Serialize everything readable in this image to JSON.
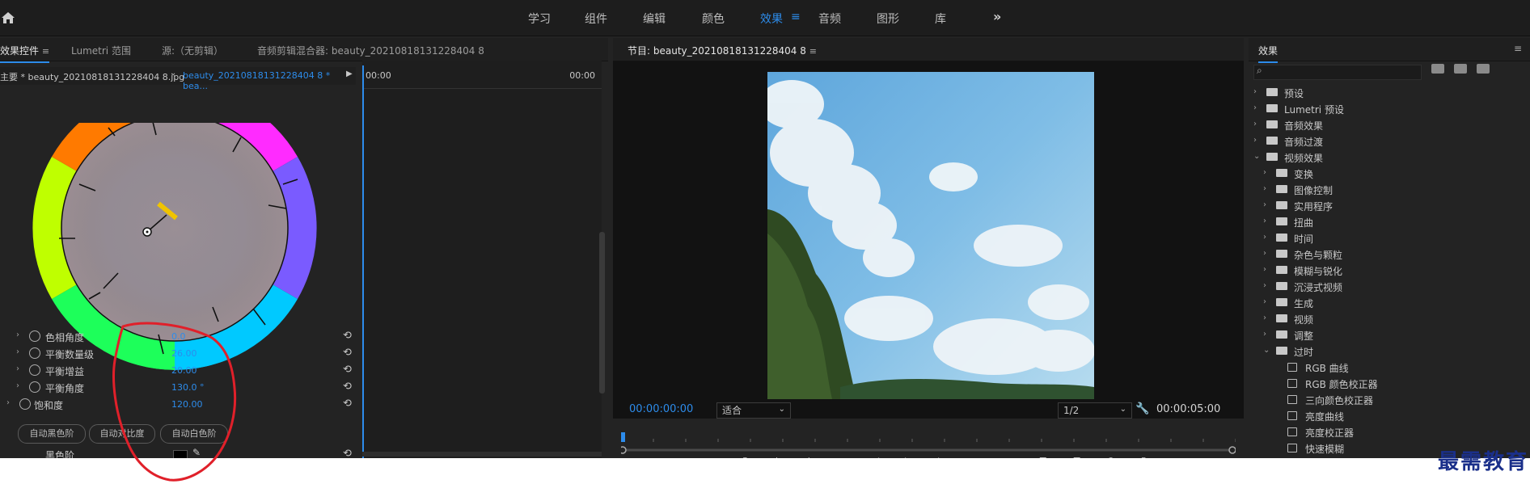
{
  "workspaces": [
    {
      "label": "学习",
      "active": false
    },
    {
      "label": "组件",
      "active": false
    },
    {
      "label": "编辑",
      "active": false
    },
    {
      "label": "颜色",
      "active": false
    },
    {
      "label": "效果",
      "active": true
    },
    {
      "label": "音频",
      "active": false
    },
    {
      "label": "图形",
      "active": false
    },
    {
      "label": "库",
      "active": false
    }
  ],
  "left": {
    "tabs": [
      "效果控件",
      "Lumetri 范围",
      "源:（无剪辑）",
      "音频剪辑混合器: beauty_20210818131228404 8"
    ],
    "source_a": "主要 * beauty_20210818131228404 8.jpg",
    "source_b": "beauty_20210818131228404 8 * bea...",
    "time_start": "00:00",
    "time_end": "00:00",
    "props": [
      {
        "label": "色相角度",
        "value": "0.0"
      },
      {
        "label": "平衡数量级",
        "value": "26.00"
      },
      {
        "label": "平衡增益",
        "value": "20.00"
      },
      {
        "label": "平衡角度",
        "value": "130.0 °"
      },
      {
        "label": "饱和度",
        "value": "120.00"
      }
    ],
    "buttons": [
      "自动黑色阶",
      "自动对比度",
      "自动白色阶"
    ],
    "black_level": "黑色阶"
  },
  "program": {
    "title": "节目: beauty_20210818131228404 8",
    "timecode_current": "00:00:00:00",
    "fit": "适合",
    "resolution": "1/2",
    "timecode_duration": "00:00:05:00"
  },
  "effects": {
    "title": "效果",
    "tree": [
      {
        "label": "预设",
        "level": 0,
        "open": false,
        "kind": "star"
      },
      {
        "label": "Lumetri 预设",
        "level": 0,
        "open": false,
        "kind": "star"
      },
      {
        "label": "音频效果",
        "level": 0,
        "open": false,
        "kind": "folder"
      },
      {
        "label": "音频过渡",
        "level": 0,
        "open": false,
        "kind": "folder"
      },
      {
        "label": "视频效果",
        "level": 0,
        "open": true,
        "kind": "folder"
      },
      {
        "label": "变换",
        "level": 1,
        "open": false,
        "kind": "folder"
      },
      {
        "label": "图像控制",
        "level": 1,
        "open": false,
        "kind": "folder"
      },
      {
        "label": "实用程序",
        "level": 1,
        "open": false,
        "kind": "folder"
      },
      {
        "label": "扭曲",
        "level": 1,
        "open": false,
        "kind": "folder"
      },
      {
        "label": "时间",
        "level": 1,
        "open": false,
        "kind": "folder"
      },
      {
        "label": "杂色与颗粒",
        "level": 1,
        "open": false,
        "kind": "folder"
      },
      {
        "label": "模糊与锐化",
        "level": 1,
        "open": false,
        "kind": "folder"
      },
      {
        "label": "沉浸式视频",
        "level": 1,
        "open": false,
        "kind": "folder"
      },
      {
        "label": "生成",
        "level": 1,
        "open": false,
        "kind": "folder"
      },
      {
        "label": "视频",
        "level": 1,
        "open": false,
        "kind": "folder"
      },
      {
        "label": "调整",
        "level": 1,
        "open": false,
        "kind": "folder"
      },
      {
        "label": "过时",
        "level": 1,
        "open": true,
        "kind": "folder"
      },
      {
        "label": "RGB 曲线",
        "level": 2,
        "open": false,
        "kind": "effect"
      },
      {
        "label": "RGB 颜色校正器",
        "level": 2,
        "open": false,
        "kind": "effect"
      },
      {
        "label": "三向颜色校正器",
        "level": 2,
        "open": false,
        "kind": "effect"
      },
      {
        "label": "亮度曲线",
        "level": 2,
        "open": false,
        "kind": "effect"
      },
      {
        "label": "亮度校正器",
        "level": 2,
        "open": false,
        "kind": "effect"
      },
      {
        "label": "快速模糊",
        "level": 2,
        "open": false,
        "kind": "effect"
      }
    ]
  },
  "watermark": "最需教育",
  "colors": {
    "accent": "#2d8ceb",
    "panel": "#232323",
    "annotation": "#e0202a"
  }
}
